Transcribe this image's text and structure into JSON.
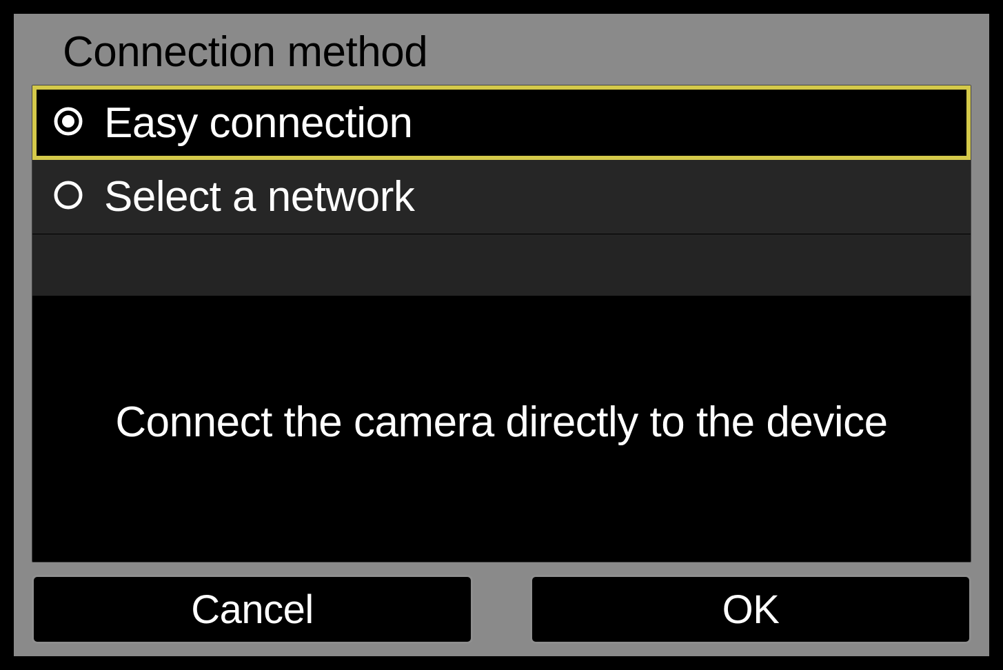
{
  "title": "Connection method",
  "options": [
    {
      "label": "Easy connection",
      "selected": true
    },
    {
      "label": "Select a network",
      "selected": false
    }
  ],
  "description": "Connect the camera directly to the device",
  "buttons": {
    "cancel": "Cancel",
    "ok": "OK"
  },
  "colors": {
    "highlight": "#d4c94a",
    "background": "#8a8a8a"
  }
}
